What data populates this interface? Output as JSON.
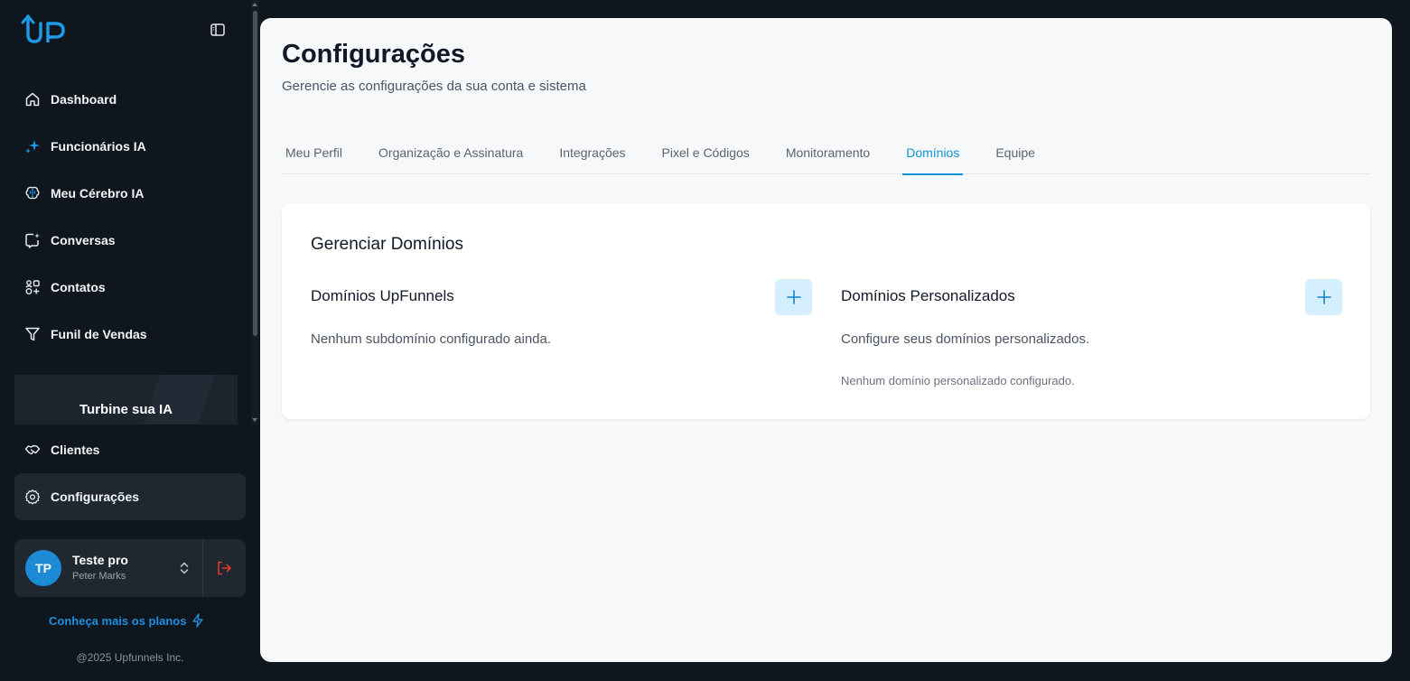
{
  "brand": {
    "logo_text": "UP",
    "accent_color": "#1e8fe0"
  },
  "sidebar": {
    "collapse_icon": "sidebar-toggle-icon",
    "items": [
      {
        "label": "Dashboard",
        "icon": "home-icon"
      },
      {
        "label": "Funcionários IA",
        "icon": "sparkles-icon"
      },
      {
        "label": "Meu Cérebro IA",
        "icon": "brain-icon"
      },
      {
        "label": "Conversas",
        "icon": "chat-icon"
      },
      {
        "label": "Contatos",
        "icon": "contacts-icon"
      },
      {
        "label": "Funil de Vendas",
        "icon": "funnel-icon"
      }
    ],
    "promo_label": "Turbine sua IA",
    "bottom_items": [
      {
        "label": "Clientes",
        "icon": "handshake-icon"
      },
      {
        "label": "Configurações",
        "icon": "gear-icon",
        "active": true
      }
    ],
    "user": {
      "initials": "TP",
      "name": "Teste pro",
      "subtitle": "Peter Marks"
    },
    "plans_link": "Conheça mais os planos",
    "copyright": "@2025 Upfunnels Inc."
  },
  "main": {
    "title": "Configurações",
    "subtitle": "Gerencie as configurações da sua conta e sistema",
    "tabs": [
      {
        "label": "Meu Perfil"
      },
      {
        "label": "Organização e Assinatura"
      },
      {
        "label": "Integrações"
      },
      {
        "label": "Pixel e Códigos"
      },
      {
        "label": "Monitoramento"
      },
      {
        "label": "Domínios",
        "active": true
      },
      {
        "label": "Equipe"
      }
    ],
    "card": {
      "title": "Gerenciar Domínios",
      "left": {
        "title": "Domínios UpFunnels",
        "empty_text": "Nenhum subdomínio configurado ainda."
      },
      "right": {
        "title": "Domínios Personalizados",
        "description": "Configure seus domínios personalizados.",
        "empty_text": "Nenhum domínio personalizado configurado."
      }
    }
  }
}
